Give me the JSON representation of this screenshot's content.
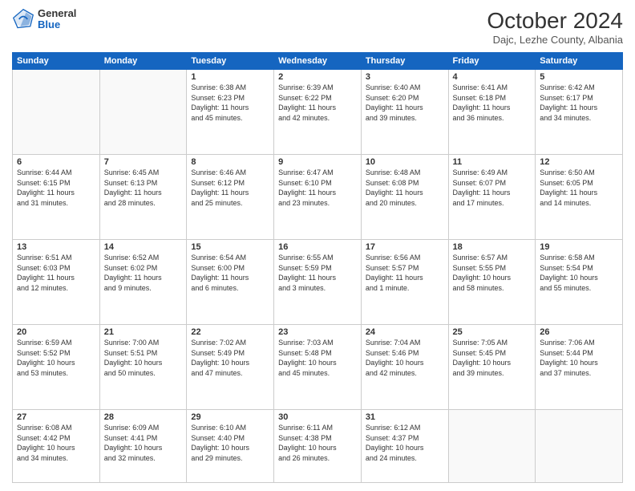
{
  "header": {
    "logo_general": "General",
    "logo_blue": "Blue",
    "month_title": "October 2024",
    "location": "Dajc, Lezhe County, Albania"
  },
  "days_of_week": [
    "Sunday",
    "Monday",
    "Tuesday",
    "Wednesday",
    "Thursday",
    "Friday",
    "Saturday"
  ],
  "weeks": [
    [
      {
        "day": "",
        "info": ""
      },
      {
        "day": "",
        "info": ""
      },
      {
        "day": "1",
        "info": "Sunrise: 6:38 AM\nSunset: 6:23 PM\nDaylight: 11 hours\nand 45 minutes."
      },
      {
        "day": "2",
        "info": "Sunrise: 6:39 AM\nSunset: 6:22 PM\nDaylight: 11 hours\nand 42 minutes."
      },
      {
        "day": "3",
        "info": "Sunrise: 6:40 AM\nSunset: 6:20 PM\nDaylight: 11 hours\nand 39 minutes."
      },
      {
        "day": "4",
        "info": "Sunrise: 6:41 AM\nSunset: 6:18 PM\nDaylight: 11 hours\nand 36 minutes."
      },
      {
        "day": "5",
        "info": "Sunrise: 6:42 AM\nSunset: 6:17 PM\nDaylight: 11 hours\nand 34 minutes."
      }
    ],
    [
      {
        "day": "6",
        "info": "Sunrise: 6:44 AM\nSunset: 6:15 PM\nDaylight: 11 hours\nand 31 minutes."
      },
      {
        "day": "7",
        "info": "Sunrise: 6:45 AM\nSunset: 6:13 PM\nDaylight: 11 hours\nand 28 minutes."
      },
      {
        "day": "8",
        "info": "Sunrise: 6:46 AM\nSunset: 6:12 PM\nDaylight: 11 hours\nand 25 minutes."
      },
      {
        "day": "9",
        "info": "Sunrise: 6:47 AM\nSunset: 6:10 PM\nDaylight: 11 hours\nand 23 minutes."
      },
      {
        "day": "10",
        "info": "Sunrise: 6:48 AM\nSunset: 6:08 PM\nDaylight: 11 hours\nand 20 minutes."
      },
      {
        "day": "11",
        "info": "Sunrise: 6:49 AM\nSunset: 6:07 PM\nDaylight: 11 hours\nand 17 minutes."
      },
      {
        "day": "12",
        "info": "Sunrise: 6:50 AM\nSunset: 6:05 PM\nDaylight: 11 hours\nand 14 minutes."
      }
    ],
    [
      {
        "day": "13",
        "info": "Sunrise: 6:51 AM\nSunset: 6:03 PM\nDaylight: 11 hours\nand 12 minutes."
      },
      {
        "day": "14",
        "info": "Sunrise: 6:52 AM\nSunset: 6:02 PM\nDaylight: 11 hours\nand 9 minutes."
      },
      {
        "day": "15",
        "info": "Sunrise: 6:54 AM\nSunset: 6:00 PM\nDaylight: 11 hours\nand 6 minutes."
      },
      {
        "day": "16",
        "info": "Sunrise: 6:55 AM\nSunset: 5:59 PM\nDaylight: 11 hours\nand 3 minutes."
      },
      {
        "day": "17",
        "info": "Sunrise: 6:56 AM\nSunset: 5:57 PM\nDaylight: 11 hours\nand 1 minute."
      },
      {
        "day": "18",
        "info": "Sunrise: 6:57 AM\nSunset: 5:55 PM\nDaylight: 10 hours\nand 58 minutes."
      },
      {
        "day": "19",
        "info": "Sunrise: 6:58 AM\nSunset: 5:54 PM\nDaylight: 10 hours\nand 55 minutes."
      }
    ],
    [
      {
        "day": "20",
        "info": "Sunrise: 6:59 AM\nSunset: 5:52 PM\nDaylight: 10 hours\nand 53 minutes."
      },
      {
        "day": "21",
        "info": "Sunrise: 7:00 AM\nSunset: 5:51 PM\nDaylight: 10 hours\nand 50 minutes."
      },
      {
        "day": "22",
        "info": "Sunrise: 7:02 AM\nSunset: 5:49 PM\nDaylight: 10 hours\nand 47 minutes."
      },
      {
        "day": "23",
        "info": "Sunrise: 7:03 AM\nSunset: 5:48 PM\nDaylight: 10 hours\nand 45 minutes."
      },
      {
        "day": "24",
        "info": "Sunrise: 7:04 AM\nSunset: 5:46 PM\nDaylight: 10 hours\nand 42 minutes."
      },
      {
        "day": "25",
        "info": "Sunrise: 7:05 AM\nSunset: 5:45 PM\nDaylight: 10 hours\nand 39 minutes."
      },
      {
        "day": "26",
        "info": "Sunrise: 7:06 AM\nSunset: 5:44 PM\nDaylight: 10 hours\nand 37 minutes."
      }
    ],
    [
      {
        "day": "27",
        "info": "Sunrise: 6:08 AM\nSunset: 4:42 PM\nDaylight: 10 hours\nand 34 minutes."
      },
      {
        "day": "28",
        "info": "Sunrise: 6:09 AM\nSunset: 4:41 PM\nDaylight: 10 hours\nand 32 minutes."
      },
      {
        "day": "29",
        "info": "Sunrise: 6:10 AM\nSunset: 4:40 PM\nDaylight: 10 hours\nand 29 minutes."
      },
      {
        "day": "30",
        "info": "Sunrise: 6:11 AM\nSunset: 4:38 PM\nDaylight: 10 hours\nand 26 minutes."
      },
      {
        "day": "31",
        "info": "Sunrise: 6:12 AM\nSunset: 4:37 PM\nDaylight: 10 hours\nand 24 minutes."
      },
      {
        "day": "",
        "info": ""
      },
      {
        "day": "",
        "info": ""
      }
    ]
  ]
}
